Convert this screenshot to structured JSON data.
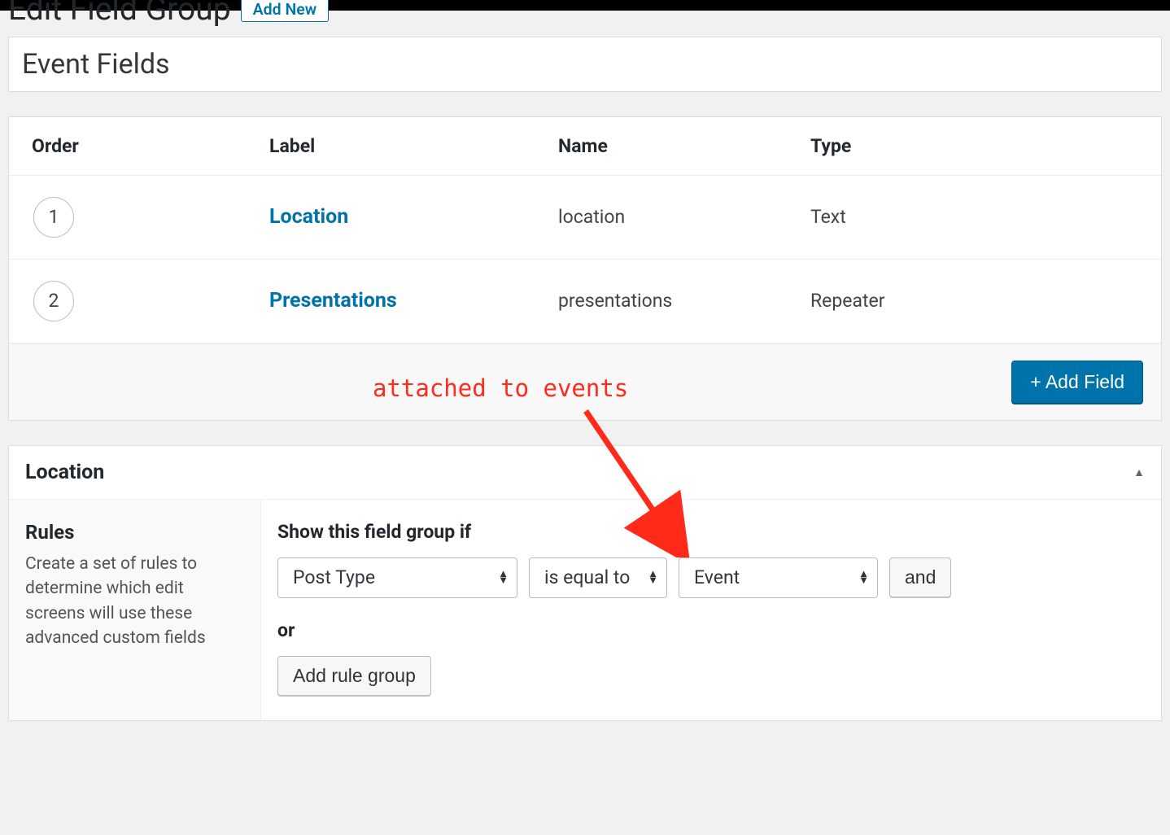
{
  "header": {
    "page_title": "Edit Field Group",
    "add_new_label": "Add New"
  },
  "title_field": {
    "value": "Event Fields"
  },
  "fields_table": {
    "columns": {
      "order": "Order",
      "label": "Label",
      "name": "Name",
      "type": "Type"
    },
    "rows": [
      {
        "order": "1",
        "label": "Location",
        "name": "location",
        "type": "Text"
      },
      {
        "order": "2",
        "label": "Presentations",
        "name": "presentations",
        "type": "Repeater"
      }
    ],
    "add_field_label": "+ Add Field"
  },
  "location_panel": {
    "title": "Location",
    "sidebar": {
      "heading": "Rules",
      "description": "Create a set of rules to determine which edit screens will use these advanced custom fields"
    },
    "rules": {
      "instruction": "Show this field group if",
      "row": {
        "param": "Post Type",
        "operator": "is equal to",
        "value": "Event",
        "and_label": "and"
      },
      "or_label": "or",
      "add_group_label": "Add rule group"
    }
  },
  "annotation": {
    "text": "attached to events"
  }
}
